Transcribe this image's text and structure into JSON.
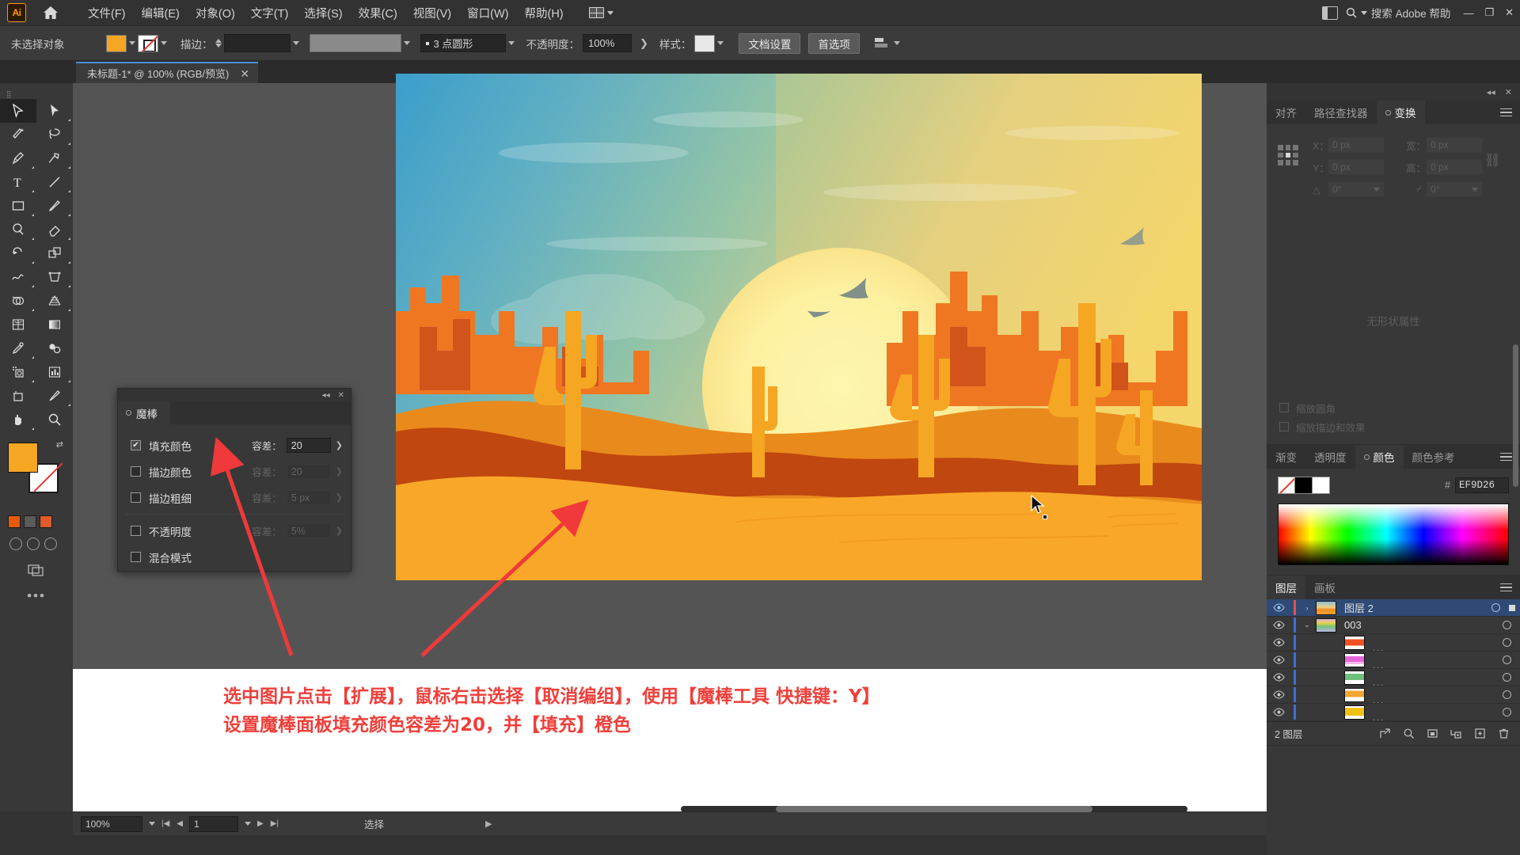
{
  "app": {
    "logo_text": "Ai",
    "title": "Adobe Illustrator"
  },
  "menubar": {
    "items": [
      {
        "label": "文件(F)",
        "name": "menu-file"
      },
      {
        "label": "编辑(E)",
        "name": "menu-edit"
      },
      {
        "label": "对象(O)",
        "name": "menu-object"
      },
      {
        "label": "文字(T)",
        "name": "menu-type"
      },
      {
        "label": "选择(S)",
        "name": "menu-select"
      },
      {
        "label": "效果(C)",
        "name": "menu-effect"
      },
      {
        "label": "视图(V)",
        "name": "menu-view"
      },
      {
        "label": "窗口(W)",
        "name": "menu-window"
      },
      {
        "label": "帮助(H)",
        "name": "menu-help"
      }
    ],
    "search_placeholder": "搜索 Adobe 帮助",
    "window_buttons": {
      "minimize": "—",
      "maximize": "❐",
      "close": "✕"
    }
  },
  "controlbar": {
    "selection_status": "未选择对象",
    "fill_color": "#F5A623",
    "stroke_label": "描边：",
    "stroke_weight": "",
    "stroke_profile": "3 点圆形",
    "opacity_label": "不透明度：",
    "opacity_value": "100%",
    "style_label": "样式：",
    "document_setup": "文档设置",
    "preferences": "首选项"
  },
  "tabbar": {
    "document_tab": "未标题-1* @ 100% (RGB/预览)",
    "close": "✕"
  },
  "toolbar": {
    "fill_swatch": "#F5A623",
    "stroke_swatch": "#FFFFFF",
    "mini_swatches": [
      "#E8590C",
      "#5A5A5A",
      "#E05A2B"
    ],
    "more_tools": "•••",
    "tools": [
      "selection-tool",
      "direct-selection-tool",
      "magic-wand-tool",
      "lasso-tool",
      "pen-tool",
      "curvature-tool",
      "type-tool",
      "line-segment-tool",
      "rectangle-tool",
      "paintbrush-tool",
      "shaper-tool",
      "eraser-tool",
      "rotate-tool",
      "scale-tool",
      "width-tool",
      "free-transform-tool",
      "shape-builder-tool",
      "perspective-grid-tool",
      "mesh-tool",
      "gradient-tool",
      "eyedropper-tool",
      "blend-tool",
      "symbol-sprayer-tool",
      "column-graph-tool",
      "artboard-tool",
      "slice-tool",
      "hand-tool",
      "zoom-tool"
    ]
  },
  "magic_wand_panel": {
    "tab_label": "魔棒",
    "close": "✕",
    "collapse": "◂◂",
    "rows": [
      {
        "label": "填充颜色",
        "checked": true,
        "tol_label": "容差：",
        "value": "20",
        "enabled": true
      },
      {
        "label": "描边颜色",
        "checked": false,
        "tol_label": "容差：",
        "value": "20",
        "enabled": false
      },
      {
        "label": "描边粗细",
        "checked": false,
        "tol_label": "容差：",
        "value": "5 px",
        "enabled": false
      },
      {
        "label": "不透明度",
        "checked": false,
        "tol_label": "容差：",
        "value": "5%",
        "enabled": false
      },
      {
        "label": "混合模式",
        "checked": false,
        "tol_label": "",
        "value": "",
        "enabled": false
      }
    ]
  },
  "right_dock": {
    "transform_panel": {
      "tabs": [
        {
          "label": "对齐",
          "active": false
        },
        {
          "label": "路径查找器",
          "active": false
        },
        {
          "label": "变换",
          "active": true
        }
      ],
      "fields": {
        "x_label": "X：",
        "x_value": "0 px",
        "y_label": "Y：",
        "y_value": "0 px",
        "w_label": "宽：",
        "w_value": "0 px",
        "h_label": "高：",
        "h_value": "0 px",
        "angle_label": "△",
        "angle_value": "0°",
        "shear_label": "⌿",
        "shear_value": "0°"
      },
      "properties_empty": "无形状属性",
      "checkboxes": [
        {
          "label": "缩放圆角"
        },
        {
          "label": "缩放描边和效果"
        }
      ]
    },
    "color_panel": {
      "tabs": [
        {
          "label": "渐变",
          "active": false
        },
        {
          "label": "透明度",
          "active": false
        },
        {
          "label": "颜色",
          "active": true
        },
        {
          "label": "颜色参考",
          "active": false
        }
      ],
      "hash": "#",
      "hex_value": "EF9D26"
    },
    "layers_panel": {
      "tabs": [
        {
          "label": "图层",
          "active": true
        },
        {
          "label": "画板",
          "active": false
        }
      ],
      "rows": [
        {
          "name": "图层 2",
          "selected": true,
          "indent": 0,
          "color": "#e05252",
          "twirl": "›",
          "thumb": "sunset",
          "eye": true
        },
        {
          "name": "003",
          "selected": false,
          "indent": 1,
          "color": "#3f6fd8",
          "twirl": "⌄",
          "thumb": "mixed",
          "eye": true
        },
        {
          "name": "...",
          "selected": false,
          "indent": 2,
          "color": "#3f6fd8",
          "twirl": "",
          "thumb": "red",
          "eye": true
        },
        {
          "name": "...",
          "selected": false,
          "indent": 2,
          "color": "#3f6fd8",
          "twirl": "",
          "thumb": "magenta",
          "eye": true
        },
        {
          "name": "...",
          "selected": false,
          "indent": 2,
          "color": "#3f6fd8",
          "twirl": "",
          "thumb": "green",
          "eye": true
        },
        {
          "name": "...",
          "selected": false,
          "indent": 2,
          "color": "#3f6fd8",
          "twirl": "",
          "thumb": "orange",
          "eye": true
        },
        {
          "name": "...",
          "selected": false,
          "indent": 2,
          "color": "#3f6fd8",
          "twirl": "",
          "thumb": "yellow",
          "eye": true
        }
      ],
      "footer_count": "2 图层",
      "footer_icons": [
        "locate-object-icon",
        "search-icon",
        "make-mask-icon",
        "new-sublayer-icon",
        "new-layer-icon",
        "delete-layer-icon"
      ]
    }
  },
  "annotation": {
    "line1": "选中图片点击【扩展】，鼠标右击选择【取消编组】，使用【魔棒工具 快捷键：Y】",
    "line2": "设置魔棒面板填充颜色容差为20，并【填充】橙色",
    "color": "#EF3F3A"
  },
  "statusbar": {
    "zoom": "100%",
    "page": "1",
    "status_text": "选择"
  },
  "artwork": {
    "title": "Desert sunset illustration",
    "palette": {
      "sky_top": "#3fa0cc",
      "sky_mid": "#8fc3b0",
      "sky_warm": "#f0cf6e",
      "sun": "#fdf2a8",
      "rock_dark": "#d2541a",
      "rock_mid": "#ef7722",
      "sand_light": "#f9a728",
      "sand_mid": "#e98a1c",
      "shadow": "#c0470f",
      "cactus": "#f5a623"
    }
  }
}
